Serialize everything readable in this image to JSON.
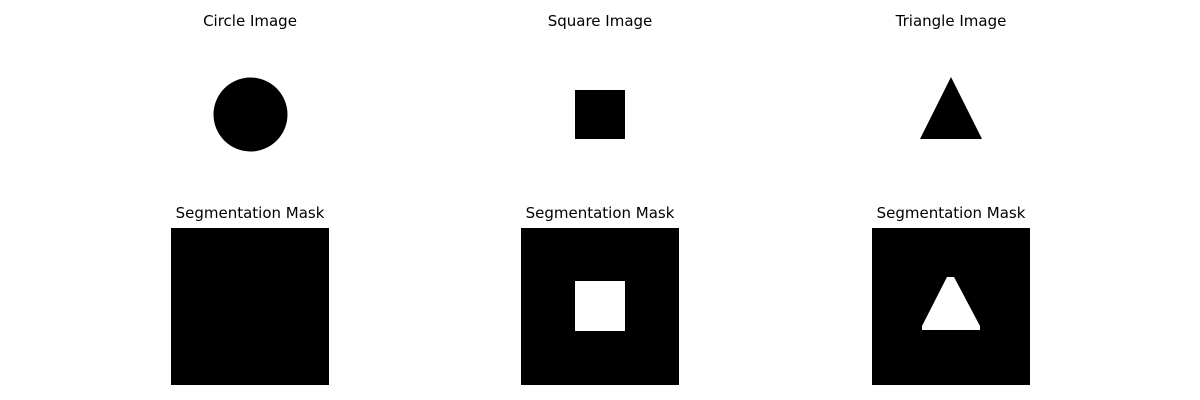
{
  "figure": {
    "colors": {
      "foreground": "#000000",
      "background": "#ffffff"
    },
    "top_row": [
      {
        "title": "Circle Image",
        "shape": "circle"
      },
      {
        "title": "Square Image",
        "shape": "square"
      },
      {
        "title": "Triangle Image",
        "shape": "triangle"
      }
    ],
    "bottom_row": [
      {
        "title": "Segmentation Mask",
        "mask": "empty"
      },
      {
        "title": "Segmentation Mask",
        "mask": "square"
      },
      {
        "title": "Segmentation Mask",
        "mask": "triangle"
      }
    ]
  }
}
